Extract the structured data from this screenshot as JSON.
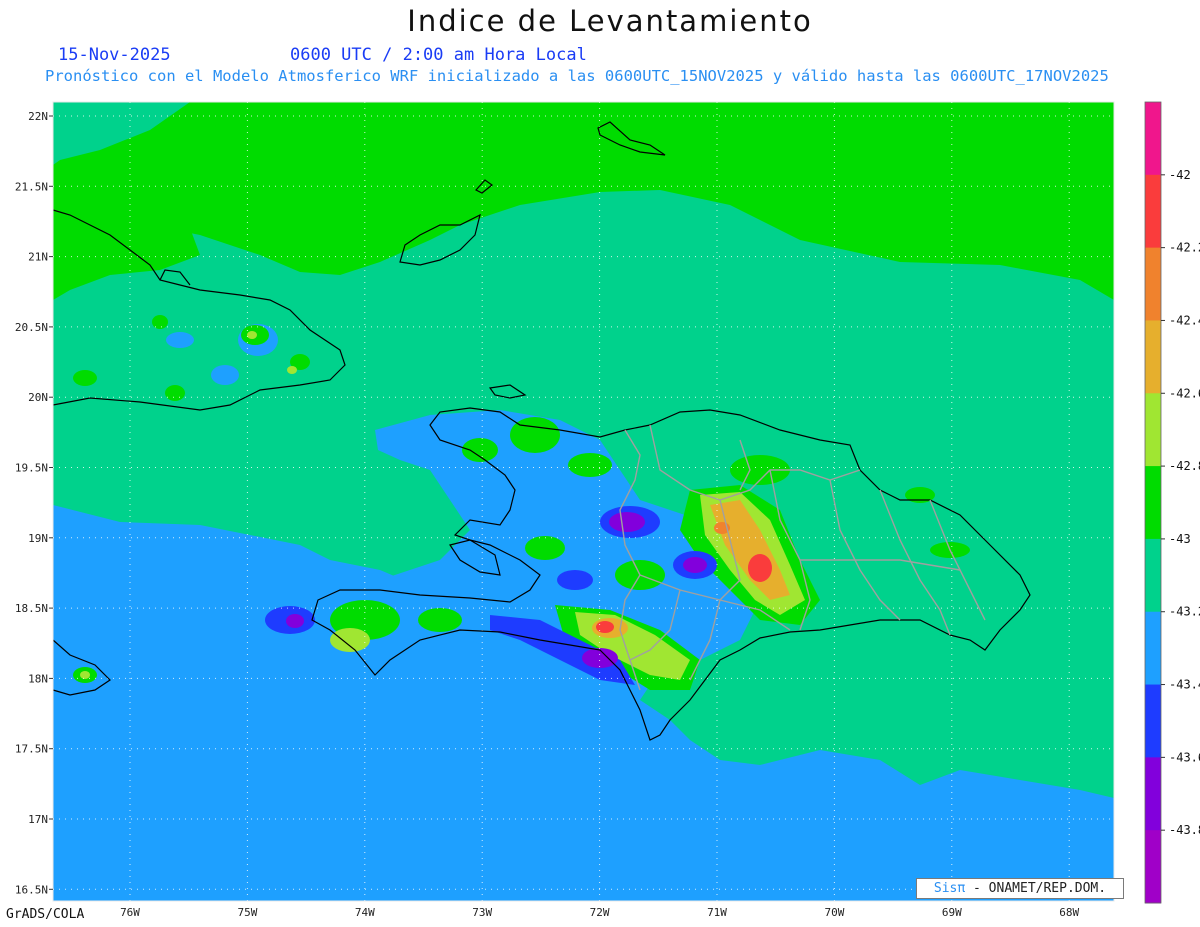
{
  "header": {
    "title": "Indice de Levantamiento",
    "date": "15-Nov-2025",
    "time": "0600 UTC / 2:00 am Hora Local",
    "subtitle": "Pronóstico con el Modelo Atmosferico WRF inicializado a las 0600UTC_15NOV2025 y válido hasta las  0600UTC_17NOV2025"
  },
  "axes": {
    "lat_labels": [
      "22N",
      "21.5N",
      "21N",
      "20.5N",
      "20N",
      "19.5N",
      "19N",
      "18.5N",
      "18N",
      "17.5N",
      "17N",
      "16.5N"
    ],
    "lon_labels": [
      "76W",
      "75W",
      "74W",
      "73W",
      "72W",
      "71W",
      "70W",
      "69W",
      "68W"
    ]
  },
  "legend": {
    "labels": [
      "-42",
      "-42.2",
      "-42.4",
      "-42.6",
      "-42.8",
      "-43",
      "-43.2",
      "-43.4",
      "-43.6",
      "-43.8"
    ],
    "colors": [
      "#f0168c",
      "#fa3c3c",
      "#f0822d",
      "#e6af2d",
      "#a0e632",
      "#00dc00",
      "#00d28c",
      "#1ea0ff",
      "#1e3cff",
      "#8200dc",
      "#a000c8"
    ]
  },
  "map_colors": {
    "sea_base": "#1ea0ff",
    "mid_band": "#00d28c",
    "north_band": "#00dc00"
  },
  "footer": {
    "credit": "GrADS/COLA",
    "sis_label": "Sisπ",
    "org_label": " - ONAMET/REP.DOM."
  }
}
